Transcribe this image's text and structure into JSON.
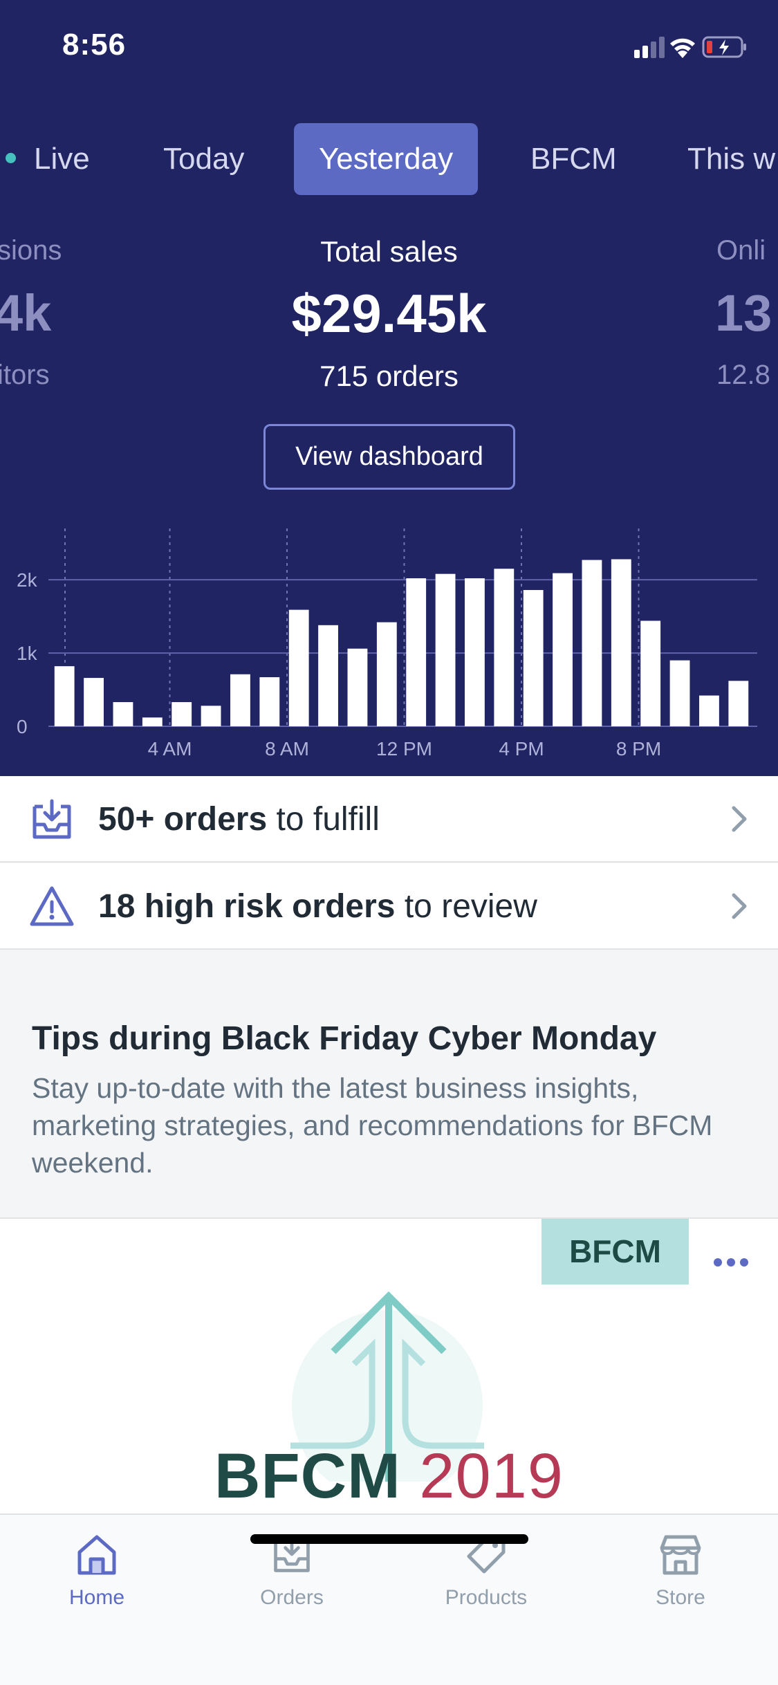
{
  "status": {
    "time": "8:56"
  },
  "tabs": [
    {
      "label": "Live"
    },
    {
      "label": "Today"
    },
    {
      "label": "Yesterday"
    },
    {
      "label": "BFCM"
    },
    {
      "label": "This w"
    }
  ],
  "metrics": {
    "left": {
      "title": "sions",
      "value": "4k",
      "sub": "itors"
    },
    "center": {
      "title": "Total sales",
      "value": "$29.45k",
      "sub": "715 orders"
    },
    "right": {
      "title": "Onli",
      "value": "13",
      "sub": "12.8"
    }
  },
  "dashboard_button": "View dashboard",
  "chart_data": {
    "type": "bar",
    "ylim": [
      0,
      2700
    ],
    "y_ticks": [
      {
        "value": 0,
        "label": "0"
      },
      {
        "value": 1000,
        "label": "1k"
      },
      {
        "value": 2000,
        "label": "2k"
      }
    ],
    "x_ticks": [
      {
        "hour": 4,
        "label": "4 AM"
      },
      {
        "hour": 8,
        "label": "8 AM"
      },
      {
        "hour": 12,
        "label": "12 PM"
      },
      {
        "hour": 16,
        "label": "4 PM"
      },
      {
        "hour": 20,
        "label": "8 PM"
      }
    ],
    "categories": [
      "0",
      "1",
      "2",
      "3",
      "4",
      "5",
      "6",
      "7",
      "8",
      "9",
      "10",
      "11",
      "12",
      "13",
      "14",
      "15",
      "16",
      "17",
      "18",
      "19",
      "20",
      "21",
      "22",
      "23"
    ],
    "values": [
      820,
      660,
      330,
      120,
      330,
      280,
      710,
      670,
      1590,
      1380,
      1060,
      1420,
      2020,
      2080,
      2020,
      2150,
      1860,
      2090,
      2270,
      2280,
      1440,
      900,
      420,
      620
    ],
    "grid": true
  },
  "fulfill_row": {
    "bold": "50+ orders",
    "rest": " to fulfill"
  },
  "risk_row": {
    "bold": "18 high risk orders",
    "rest": " to review"
  },
  "tips": {
    "title": "Tips during Black Friday Cyber Monday",
    "description": "Stay up-to-date with the latest business insights, marketing strategies, and recommendations for BFCM weekend."
  },
  "card": {
    "badge": "BFCM",
    "heading_word": "BFCM",
    "heading_year": "2019"
  },
  "tabbar": [
    {
      "label": "Home",
      "icon": "home-icon",
      "active": true
    },
    {
      "label": "Orders",
      "icon": "orders-icon",
      "active": false
    },
    {
      "label": "Products",
      "icon": "tag-icon",
      "active": false
    },
    {
      "label": "Store",
      "icon": "store-icon",
      "active": false
    }
  ],
  "colors": {
    "hero_bg": "#212463",
    "accent": "#5c6ac4",
    "live": "#47c1bf",
    "bfcm_green": "#1f4a46",
    "bfcm_red": "#b63a55"
  }
}
